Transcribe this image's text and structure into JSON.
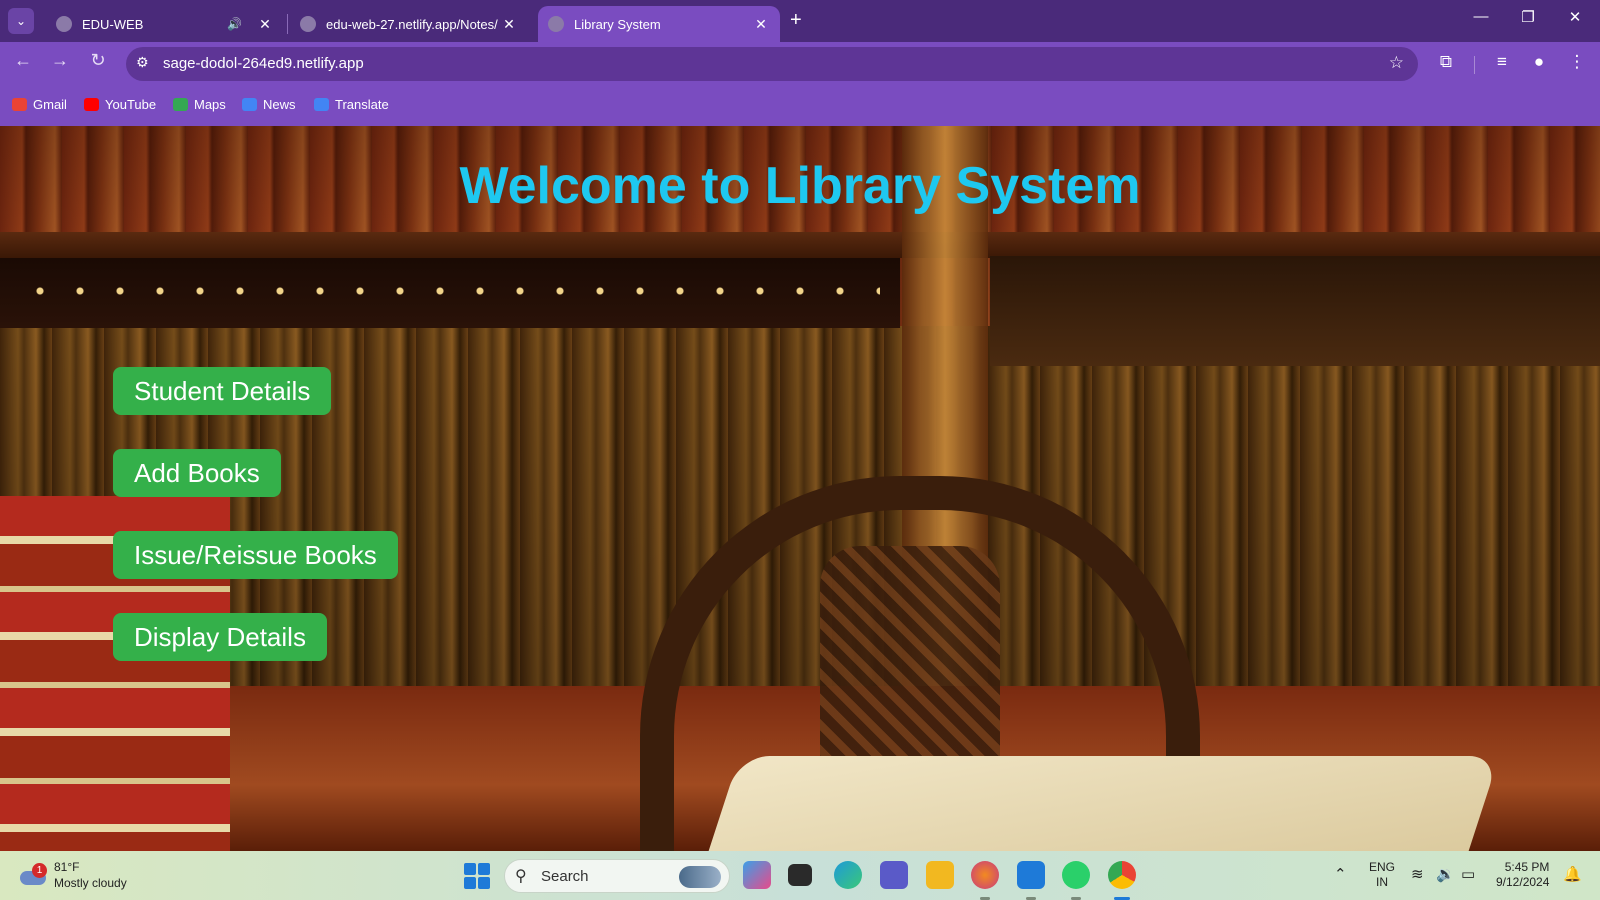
{
  "browser": {
    "tabs": [
      {
        "title": "EDU-WEB",
        "active": false,
        "audio": true
      },
      {
        "title": "edu-web-27.netlify.app/Notes/",
        "active": false,
        "audio": false
      },
      {
        "title": "Library System",
        "active": true,
        "audio": false
      }
    ],
    "address": "sage-dodol-264ed9.netlify.app",
    "bookmarks": [
      {
        "label": "Gmail",
        "color": "#ea4335"
      },
      {
        "label": "YouTube",
        "color": "#ff0000"
      },
      {
        "label": "Maps",
        "color": "#34a853"
      },
      {
        "label": "News",
        "color": "#4285f4"
      },
      {
        "label": "Translate",
        "color": "#4285f4"
      }
    ],
    "theme_color": "#7a4cc0"
  },
  "page": {
    "heading": "Welcome to Library System",
    "heading_color": "#1ec8f0",
    "button_color": "#34b04a",
    "buttons": [
      {
        "label": "Student Details"
      },
      {
        "label": "Add Books"
      },
      {
        "label": "Issue/Reissue Books"
      },
      {
        "label": "Display Details"
      }
    ]
  },
  "taskbar": {
    "weather": {
      "temp": "81°F",
      "condition": "Mostly cloudy",
      "badge": "1"
    },
    "search_label": "Search",
    "lang_line1": "ENG",
    "lang_line2": "IN",
    "time": "5:45 PM",
    "date": "9/12/2024"
  }
}
